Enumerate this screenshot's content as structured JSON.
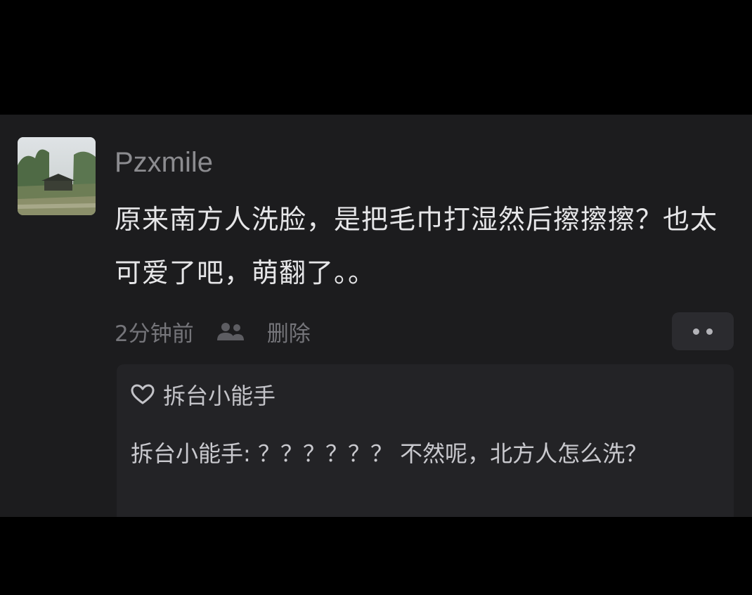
{
  "comment": {
    "username": "Pzxmile",
    "text": "原来南方人洗脸，是把毛巾打湿然后擦擦擦？也太可爱了吧，萌翻了。。",
    "time": "2分钟前",
    "share_icon": "share-users-icon",
    "delete_label": "删除",
    "more_icon": "more-dots-icon"
  },
  "reply": {
    "like_icon": "heart-icon",
    "liked_by": "拆台小能手",
    "text": "拆台小能手: ？？？？？？ 不然呢，北方人怎么洗？"
  },
  "colors": {
    "background": "#000000",
    "panel": "#1c1c1e",
    "reply_box": "#232326",
    "username": "#8c8c90",
    "body_text": "#e6e6e8",
    "meta_text": "#75757a"
  }
}
